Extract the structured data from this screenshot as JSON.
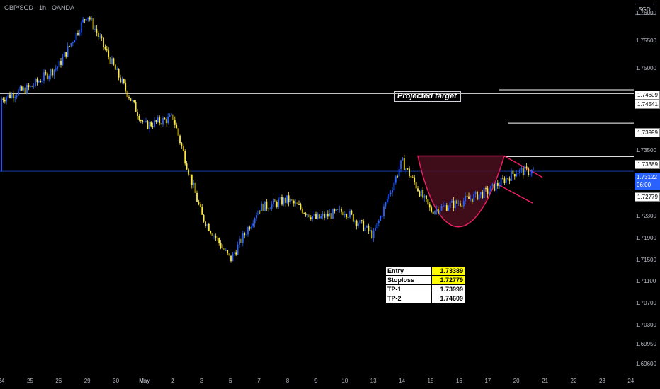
{
  "header": {
    "symbol": "GBP/SGD · 1h · OANDA",
    "currency": "SGD"
  },
  "annotations": {
    "projected_target": "Projected target"
  },
  "trade_table": [
    {
      "key": "Entry",
      "value": "1.73389",
      "highlight": true
    },
    {
      "key": "Stoploss",
      "value": "1.72779",
      "highlight": true
    },
    {
      "key": "TP-1",
      "value": "1.73999",
      "highlight": false
    },
    {
      "key": "TP-2",
      "value": "1.74609",
      "highlight": false
    }
  ],
  "price_tags": {
    "tp2": "1.74609",
    "upper_line": "1.74541",
    "tp1": "1.73999",
    "entry": "1.73389",
    "current": "1.73122",
    "countdown": "06:00",
    "stoploss": "1.72779"
  },
  "colors": {
    "up": "#2962ff",
    "down": "#ffeb3b",
    "cup_fill": "#4a0e1e",
    "cup_stroke": "#e91e63",
    "current_price": "#2962ff"
  },
  "chart_data": {
    "type": "candlestick",
    "y_ticks": [
      "1.76000",
      "1.75500",
      "1.75000",
      "1.73500",
      "1.72300",
      "1.71900",
      "1.71500",
      "1.71100",
      "1.70700",
      "1.70300",
      "1.69950",
      "1.69600"
    ],
    "x_ticks": [
      "24",
      "25",
      "26",
      "29",
      "30",
      "May",
      "2",
      "3",
      "6",
      "7",
      "8",
      "9",
      "10",
      "13",
      "14",
      "15",
      "16",
      "17",
      "20",
      "21",
      "22",
      "23",
      "24"
    ],
    "ylim": [
      1.694,
      1.7625
    ],
    "horizontal_levels": [
      1.74609,
      1.74541,
      1.73999,
      1.73389,
      1.73122,
      1.72779
    ],
    "price_path_anchors": [
      [
        "24",
        1.7445
      ],
      [
        "25",
        1.7465
      ],
      [
        "26",
        1.7505
      ],
      [
        "29",
        1.76
      ],
      [
        "30",
        1.7495
      ],
      [
        "May",
        1.7395
      ],
      [
        "2",
        1.741
      ],
      [
        "3",
        1.723
      ],
      [
        "6",
        1.715
      ],
      [
        "7",
        1.7245
      ],
      [
        "8",
        1.726
      ],
      [
        "9",
        1.7225
      ],
      [
        "10",
        1.724
      ],
      [
        "13",
        1.7195
      ],
      [
        "14",
        1.733
      ],
      [
        "15",
        1.724
      ],
      [
        "16",
        1.7255
      ],
      [
        "17",
        1.7275
      ],
      [
        "20",
        1.7312
      ]
    ]
  }
}
